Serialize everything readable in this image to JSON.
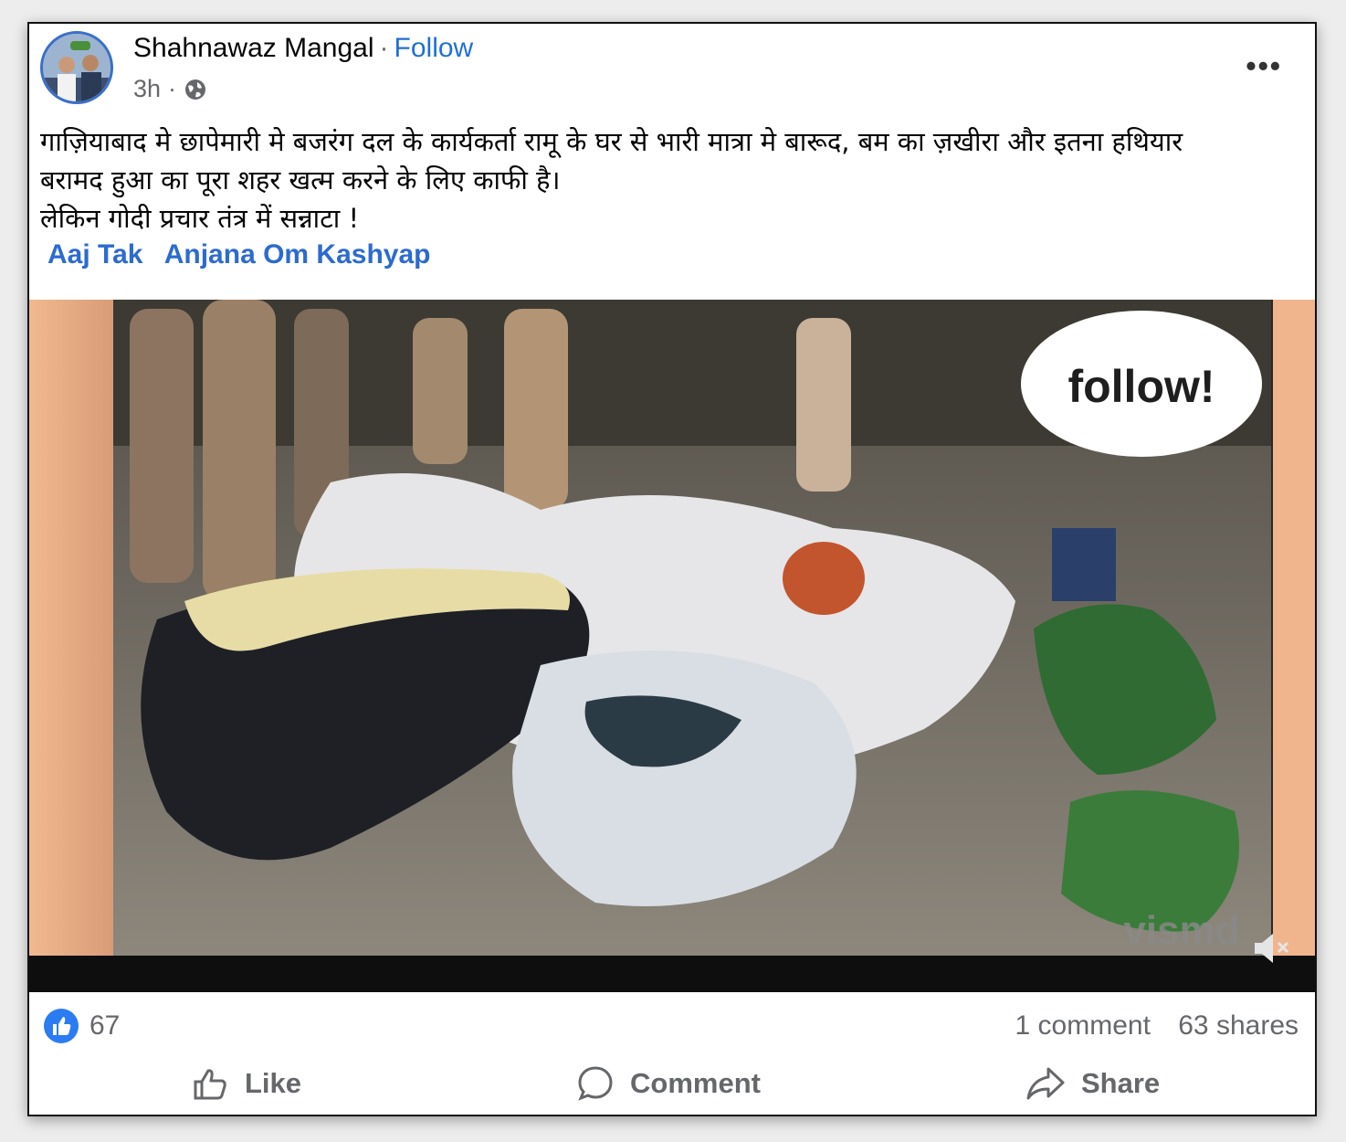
{
  "post": {
    "author": "Shahnawaz Mangal",
    "separator": "·",
    "follow_label": "Follow",
    "time": "3h",
    "time_separator": "·",
    "audience_icon": "globe-icon",
    "more_label": "•••",
    "text_lines": [
      "गाज़ियाबाद मे छापेमारी मे बजरंग दल के कार्यकर्ता रामू के घर से भारी मात्रा मे बारूद, बम का ज़खीरा और इतना हथियार",
      "बरामद हुआ का पूरा शहर खत्म करने के लिए काफी है।",
      "लेकिन गोदी प्रचार तंत्र में सन्नाटा !"
    ],
    "tags": [
      "Aaj Tak",
      "Anjana Om Kashyap"
    ]
  },
  "media": {
    "overlay_text": "follow!",
    "watermark": "vismd",
    "mute_icon": "muted-speaker-icon"
  },
  "stats": {
    "like_count": "67",
    "comments": "1 comment",
    "shares": "63 shares"
  },
  "actions": {
    "like_label": "Like",
    "comment_label": "Comment",
    "share_label": "Share"
  },
  "colors": {
    "link_blue": "#1f6fd6",
    "like_blue": "#2b7cf2",
    "muted_text": "#65676b"
  }
}
